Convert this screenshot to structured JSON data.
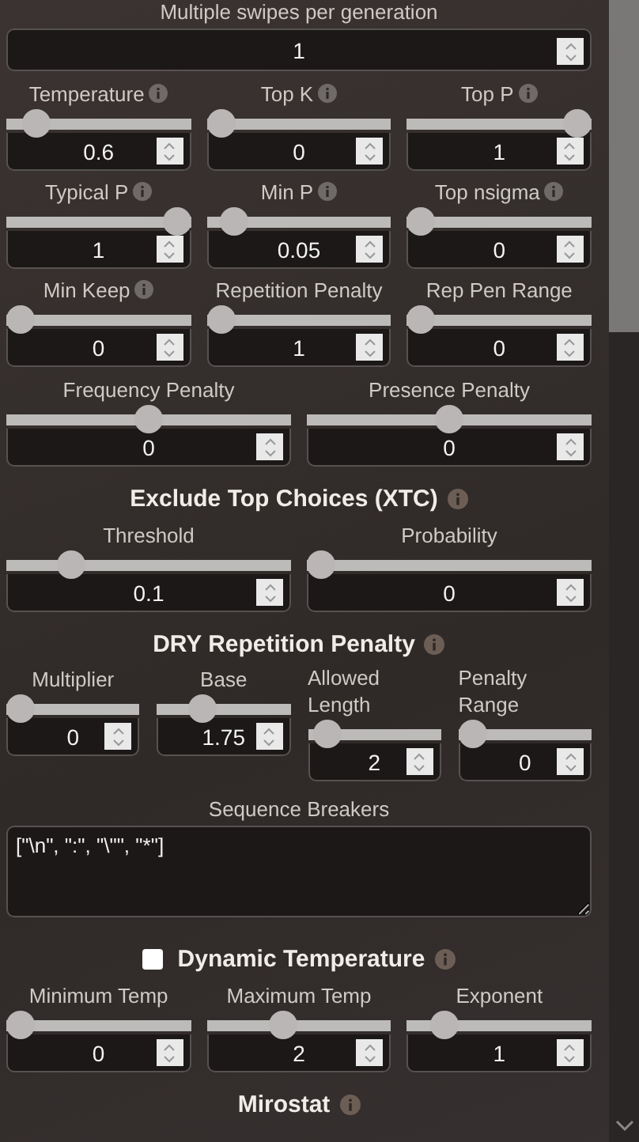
{
  "sections": [
    {
      "kind": "number",
      "label": "Multiple swipes per generation",
      "value": "1"
    },
    {
      "kind": "grid",
      "controls": [
        {
          "label": "Temperature",
          "info": true,
          "level": 0.1,
          "value": "0.6"
        },
        {
          "label": "Top K",
          "info": true,
          "level": 0,
          "value": "0"
        },
        {
          "label": "Top P",
          "info": true,
          "level": 1,
          "value": "1"
        },
        {
          "label": "Typical P",
          "info": true,
          "level": 1,
          "value": "1"
        },
        {
          "label": "Min P",
          "info": true,
          "level": 0.08,
          "value": "0.05"
        },
        {
          "label": "Top nsigma",
          "info": true,
          "level": 0,
          "value": "0"
        },
        {
          "label": "Min Keep",
          "info": true,
          "level": 0,
          "value": "0"
        },
        {
          "label": "Repetition Penalty",
          "info": false,
          "level": 0,
          "value": "1"
        },
        {
          "label": "Rep Pen Range",
          "info": false,
          "level": 0,
          "value": "0"
        }
      ]
    },
    {
      "kind": "grid",
      "controls": [
        {
          "label": "Frequency Penalty",
          "info": false,
          "level": 0.5,
          "value": "0"
        },
        {
          "label": "Presence Penalty",
          "info": false,
          "level": 0.5,
          "value": "0"
        }
      ]
    },
    {
      "kind": "heading",
      "title": "Exclude Top Choices (XTC)",
      "info": true
    },
    {
      "kind": "grid",
      "controls": [
        {
          "label": "Threshold",
          "info": false,
          "level": 0.2,
          "value": "0.1"
        },
        {
          "label": "Probability",
          "info": false,
          "level": 0,
          "value": "0"
        }
      ]
    },
    {
      "kind": "heading",
      "title": "DRY Repetition Penalty",
      "info": true
    },
    {
      "kind": "grid",
      "controls": [
        {
          "label": "Multiplier",
          "info": false,
          "level": 0,
          "value": "0"
        },
        {
          "label": "Base",
          "info": false,
          "level": 0.3,
          "value": "1.75"
        },
        {
          "label": "Allowed Length",
          "info": false,
          "level": 0.05,
          "value": "2"
        },
        {
          "label": "Penalty Range",
          "info": false,
          "level": 0,
          "value": "0"
        }
      ]
    },
    {
      "kind": "textarea",
      "label": "Sequence Breakers",
      "value": "[\"\\n\", \":\", \"\\\"\", \"*\"]"
    },
    {
      "kind": "heading",
      "title": "Dynamic Temperature",
      "info": true,
      "checked": false
    },
    {
      "kind": "grid",
      "controls": [
        {
          "label": "Minimum Temp",
          "info": false,
          "level": 0,
          "value": "0"
        },
        {
          "label": "Maximum Temp",
          "info": false,
          "level": 0.4,
          "value": "2"
        },
        {
          "label": "Exponent",
          "info": false,
          "level": 0.15,
          "value": "1"
        }
      ]
    },
    {
      "kind": "heading",
      "title": "Mirostat",
      "info": true
    }
  ]
}
